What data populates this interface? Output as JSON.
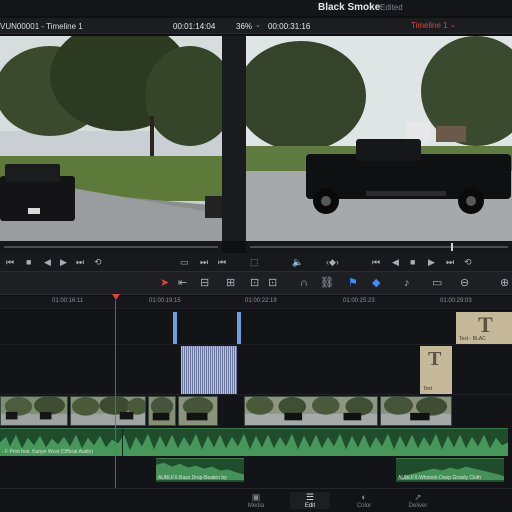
{
  "app": {
    "project_name": "Black Smoke",
    "status": "Edited"
  },
  "viewer": {
    "source_clip": "VUN00001 - Timeline 1",
    "source_timecode": "00:01:14:04",
    "zoom": "36%",
    "record_timecode": "00:00:31:16",
    "timeline_name": "Timeline 1"
  },
  "ruler": {
    "ticks": [
      "01:00:16:11",
      "01:00:19:15",
      "01:00:22:19",
      "01:00:25:23",
      "01:00:29:03"
    ]
  },
  "timeline": {
    "title_clip_main": {
      "glyph": "T",
      "label": "Text - BLAC"
    },
    "title_clip_small": {
      "glyph": "T",
      "label": "Text"
    },
    "audio_clip_1": "- F Print feat. Kanye West (Official Audio)",
    "audio_clip_2": "AUBLFX-Bass Drop-Beaten by",
    "audio_clip_3": "AUBLFX-Whoosh-Deep Growly Cloth"
  },
  "pages": [
    {
      "label": "Media",
      "icon": "media-icon"
    },
    {
      "label": "Edit",
      "icon": "edit-icon"
    },
    {
      "label": "Color",
      "icon": "color-icon"
    },
    {
      "label": "Deliver",
      "icon": "deliver-icon"
    }
  ],
  "colors": {
    "accent_red": "#e2413a",
    "marker_blue": "#3d8bff",
    "audio_green": "#1f4d2c",
    "title_tan": "#c5b99a"
  }
}
